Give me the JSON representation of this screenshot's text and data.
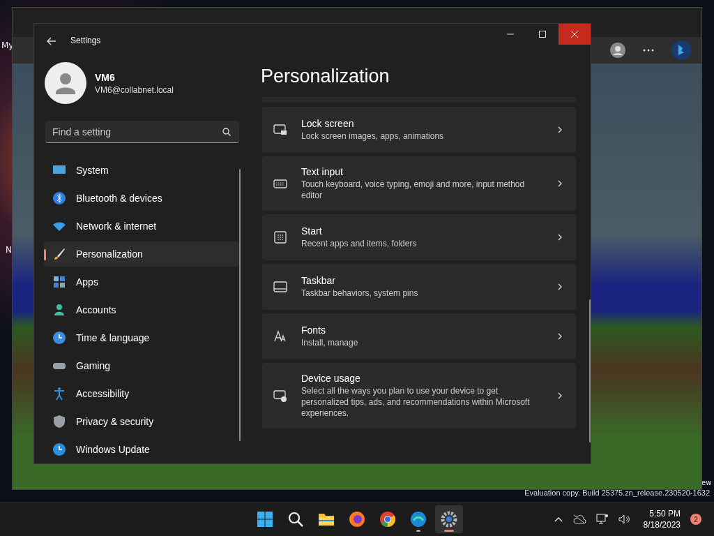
{
  "desktop": {
    "icon_labels": [
      "My",
      "N",
      "ew"
    ]
  },
  "window": {
    "title": "Settings"
  },
  "user": {
    "name": "VM6",
    "email": "VM6@collabnet.local"
  },
  "search": {
    "placeholder": "Find a setting"
  },
  "nav": [
    {
      "label": "System",
      "selected": false
    },
    {
      "label": "Bluetooth & devices",
      "selected": false
    },
    {
      "label": "Network & internet",
      "selected": false
    },
    {
      "label": "Personalization",
      "selected": true
    },
    {
      "label": "Apps",
      "selected": false
    },
    {
      "label": "Accounts",
      "selected": false
    },
    {
      "label": "Time & language",
      "selected": false
    },
    {
      "label": "Gaming",
      "selected": false
    },
    {
      "label": "Accessibility",
      "selected": false
    },
    {
      "label": "Privacy & security",
      "selected": false
    },
    {
      "label": "Windows Update",
      "selected": false
    }
  ],
  "page": {
    "title": "Personalization",
    "cards": [
      {
        "title": "Lock screen",
        "description": "Lock screen images, apps, animations"
      },
      {
        "title": "Text input",
        "description": "Touch keyboard, voice typing, emoji and more, input method editor"
      },
      {
        "title": "Start",
        "description": "Recent apps and items, folders"
      },
      {
        "title": "Taskbar",
        "description": "Taskbar behaviors, system pins"
      },
      {
        "title": "Fonts",
        "description": "Install, manage"
      },
      {
        "title": "Device usage",
        "description": "Select all the ways you plan to use your device to get personalized tips, ads, and recommendations within Microsoft experiences."
      }
    ]
  },
  "watermark": "Evaluation copy. Build 25375.zn_release.230520-1632",
  "taskbar": {
    "apps": [
      {
        "kind": "start",
        "running": false,
        "selected": false
      },
      {
        "kind": "search",
        "running": false,
        "selected": false
      },
      {
        "kind": "folder",
        "running": false,
        "selected": false
      },
      {
        "kind": "firefox",
        "running": false,
        "selected": false
      },
      {
        "kind": "chrome",
        "running": false,
        "selected": false
      },
      {
        "kind": "edge",
        "running": true,
        "selected": false
      },
      {
        "kind": "settings",
        "running": true,
        "selected": true
      }
    ],
    "time": "5:50 PM",
    "date": "8/18/2023",
    "notifications": "2"
  }
}
